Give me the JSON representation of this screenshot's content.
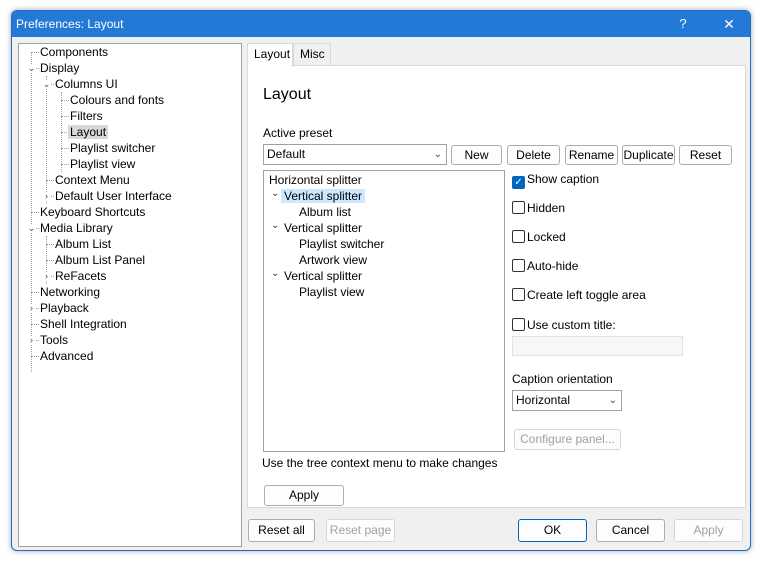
{
  "window": {
    "title": "Preferences: Layout",
    "help_glyph": "?",
    "close_glyph": "✕"
  },
  "tree": [
    {
      "label": "Components"
    },
    {
      "label": "Display"
    },
    {
      "label": "Columns UI"
    },
    {
      "label": "Colours and fonts"
    },
    {
      "label": "Filters"
    },
    {
      "label": "Layout"
    },
    {
      "label": "Playlist switcher"
    },
    {
      "label": "Playlist view"
    },
    {
      "label": "Context Menu"
    },
    {
      "label": "Default User Interface"
    },
    {
      "label": "Keyboard Shortcuts"
    },
    {
      "label": "Media Library"
    },
    {
      "label": "Album List"
    },
    {
      "label": "Album List Panel"
    },
    {
      "label": "ReFacets"
    },
    {
      "label": "Networking"
    },
    {
      "label": "Playback"
    },
    {
      "label": "Shell Integration"
    },
    {
      "label": "Tools"
    },
    {
      "label": "Advanced"
    }
  ],
  "tabs": {
    "layout": "Layout",
    "misc": "Misc"
  },
  "page": {
    "heading": "Layout",
    "active_preset_label": "Active preset",
    "preset_value": "Default",
    "preset_buttons": {
      "new": "New",
      "delete": "Delete",
      "rename": "Rename",
      "duplicate": "Duplicate",
      "reset": "Reset"
    },
    "layout_tree": [
      {
        "label": "Horizontal splitter"
      },
      {
        "label": "Vertical splitter"
      },
      {
        "label": "Album list"
      },
      {
        "label": "Vertical splitter"
      },
      {
        "label": "Playlist switcher"
      },
      {
        "label": "Artwork view"
      },
      {
        "label": "Vertical splitter"
      },
      {
        "label": "Playlist view"
      }
    ],
    "hint": "Use the tree context menu to make changes",
    "apply_label": "Apply",
    "options": {
      "show_caption": {
        "label": "Show caption",
        "checked": true
      },
      "hidden": {
        "label": "Hidden",
        "checked": false
      },
      "locked": {
        "label": "Locked",
        "checked": false
      },
      "auto_hide": {
        "label": "Auto-hide",
        "checked": false
      },
      "left_toggle": {
        "label": "Create left toggle area",
        "checked": false
      },
      "custom_title": {
        "label": "Use custom title:",
        "checked": false
      }
    },
    "caption_orientation_label": "Caption orientation",
    "caption_orientation_value": "Horizontal",
    "configure_panel_label": "Configure panel..."
  },
  "footer": {
    "reset_all": "Reset all",
    "reset_page": "Reset page",
    "ok": "OK",
    "cancel": "Cancel",
    "apply": "Apply"
  }
}
